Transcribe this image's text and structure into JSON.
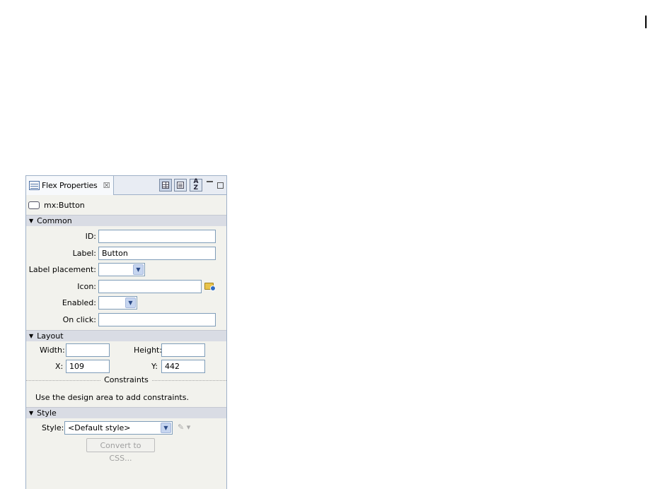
{
  "tab": {
    "title": "Flex Properties",
    "close_glyph": "☒"
  },
  "tools": [
    "standard-view-icon",
    "category-view-icon",
    "alphabetical-view-icon"
  ],
  "component": {
    "type_label": "mx:Button"
  },
  "sections": {
    "common": {
      "title": "Common",
      "id_label": "ID:",
      "id_value": "",
      "label_label": "Label:",
      "label_value": "Button",
      "label_placement_label": "Label placement:",
      "label_placement_value": "",
      "icon_label": "Icon:",
      "icon_value": "",
      "enabled_label": "Enabled:",
      "enabled_value": "",
      "onclick_label": "On click:",
      "onclick_value": ""
    },
    "layout": {
      "title": "Layout",
      "width_label": "Width:",
      "width_value": "",
      "height_label": "Height:",
      "height_value": "",
      "x_label": "X:",
      "x_value": "109",
      "y_label": "Y:",
      "y_value": "442",
      "constraints_label": "Constraints",
      "hint": "Use the design area to add constraints."
    },
    "style": {
      "title": "Style",
      "style_label": "Style:",
      "style_value": "<Default style>",
      "convert_button": "Convert to CSS..."
    }
  },
  "colors": {
    "panel_bg": "#f2f2ed",
    "section_header": "#d9dce4",
    "border": "#9fb1c8"
  }
}
